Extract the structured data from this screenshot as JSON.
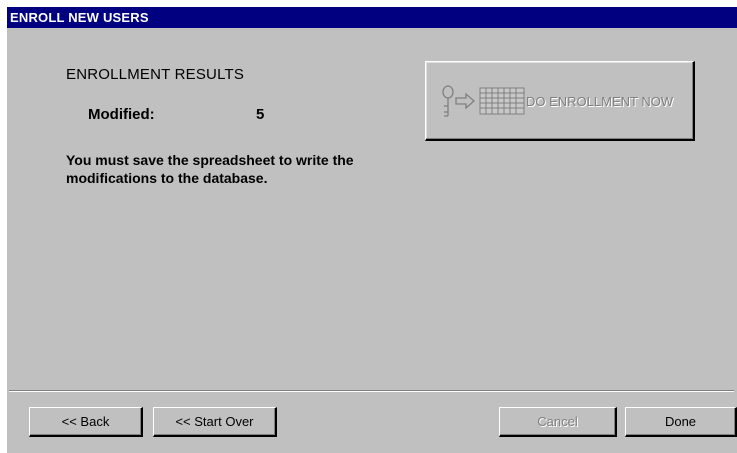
{
  "window": {
    "title": "ENROLL NEW USERS"
  },
  "results": {
    "heading": "ENROLLMENT RESULTS",
    "modified_label": "Modified:",
    "modified_value": "5",
    "message": "You must save the spreadsheet to write the modifications to the database."
  },
  "enroll_button": {
    "label": "DO ENROLLMENT NOW",
    "enabled": false,
    "icons": [
      "key-icon",
      "arrow-right-icon",
      "spreadsheet-icon"
    ]
  },
  "footer": {
    "back_label": "<< Back",
    "start_over_label": "<< Start Over",
    "cancel_label": "Cancel",
    "cancel_enabled": false,
    "done_label": "Done"
  },
  "colors": {
    "title_bar": "#000080",
    "face": "#c0c0c0",
    "disabled_text": "#808080"
  }
}
